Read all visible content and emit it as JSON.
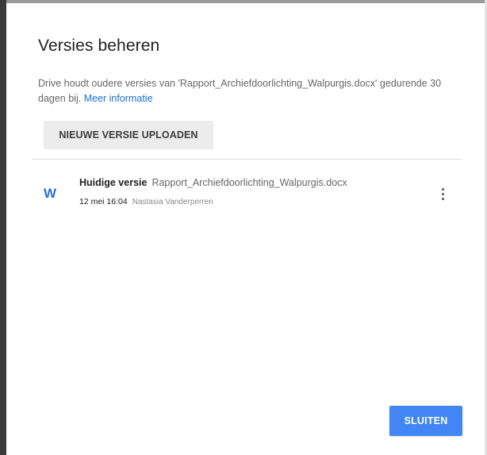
{
  "dialog": {
    "title": "Versies beheren",
    "description_text": "Drive houdt oudere versies van 'Rapport_Archiefdoorlichting_Walpurgis.docx' gedurende 30 dagen bij.",
    "info_link": "Meer informatie",
    "upload_button": "NIEUWE VERSIE UPLOADEN",
    "close_button": "SLUITEN",
    "accent_color": "#4285f4",
    "link_color": "#1a6fd9"
  },
  "versions": [
    {
      "icon": "word-document-icon",
      "icon_letter": "W",
      "icon_color": "#2b6fd6",
      "label": "Huidige versie",
      "filename": "Rapport_Archiefdoorlichting_Walpurgis.docx",
      "date": "12 mei 16:04",
      "author": "Nastasia Vanderperren",
      "menu_icon": "more-vert-icon"
    }
  ]
}
